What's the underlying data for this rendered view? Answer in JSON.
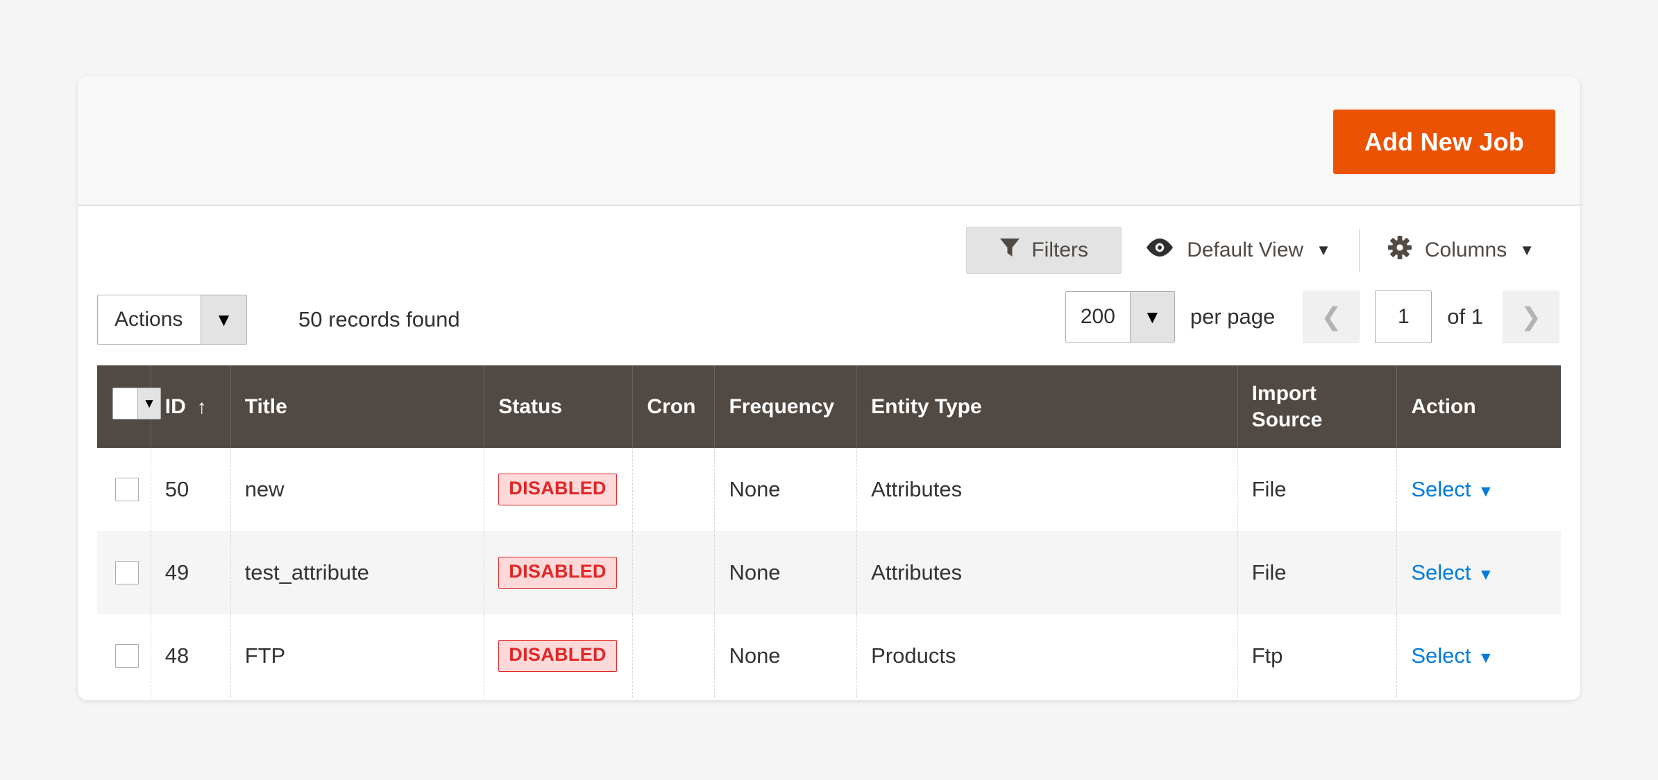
{
  "page_actions": {
    "add_new_job_label": "Add New Job"
  },
  "toolbar": {
    "filters_label": "Filters",
    "filters_icon": "funnel-icon",
    "default_view_label": "Default View",
    "default_view_icon": "eye-icon",
    "columns_label": "Columns",
    "columns_icon": "gear-icon",
    "caret": "▼"
  },
  "subbar": {
    "actions_label": "Actions",
    "actions_caret": "▼",
    "records_found": "50 records found",
    "per_page_value": "200",
    "per_page_caret": "▼",
    "per_page_label": "per page",
    "prev_icon": "❮",
    "next_icon": "❯",
    "current_page": "1",
    "total_pages_label": "of 1"
  },
  "grid": {
    "mass_select_caret": "▼",
    "sort_arrow": "↑",
    "columns": [
      {
        "key": "check",
        "label": ""
      },
      {
        "key": "id",
        "label": "ID"
      },
      {
        "key": "title",
        "label": "Title"
      },
      {
        "key": "status",
        "label": "Status"
      },
      {
        "key": "cron",
        "label": "Cron"
      },
      {
        "key": "frequency",
        "label": "Frequency"
      },
      {
        "key": "entity_type",
        "label": "Entity Type"
      },
      {
        "key": "import_source",
        "label": "Import Source"
      },
      {
        "key": "action",
        "label": "Action"
      }
    ],
    "sorted_column": "ID",
    "sort_direction": "asc",
    "action_link_label": "Select",
    "action_link_caret": "▼",
    "rows": [
      {
        "id": "50",
        "title": "new",
        "status": "DISABLED",
        "cron": "",
        "frequency": "None",
        "entity_type": "Attributes",
        "import_source": "File",
        "action": "Select"
      },
      {
        "id": "49",
        "title": "test_attribute",
        "status": "DISABLED",
        "cron": "",
        "frequency": "None",
        "entity_type": "Attributes",
        "import_source": "File",
        "action": "Select"
      },
      {
        "id": "48",
        "title": "FTP",
        "status": "DISABLED",
        "cron": "",
        "frequency": "None",
        "entity_type": "Products",
        "import_source": "Ftp",
        "action": "Select"
      }
    ]
  },
  "colors": {
    "primary_button": "#eb5202",
    "table_header_bg": "#514943",
    "link": "#007bdb",
    "badge_disabled_text": "#e22626",
    "badge_disabled_bg": "#fdd9d9",
    "page_bg": "#f5f5f5",
    "panel_bg": "#ffffff"
  }
}
